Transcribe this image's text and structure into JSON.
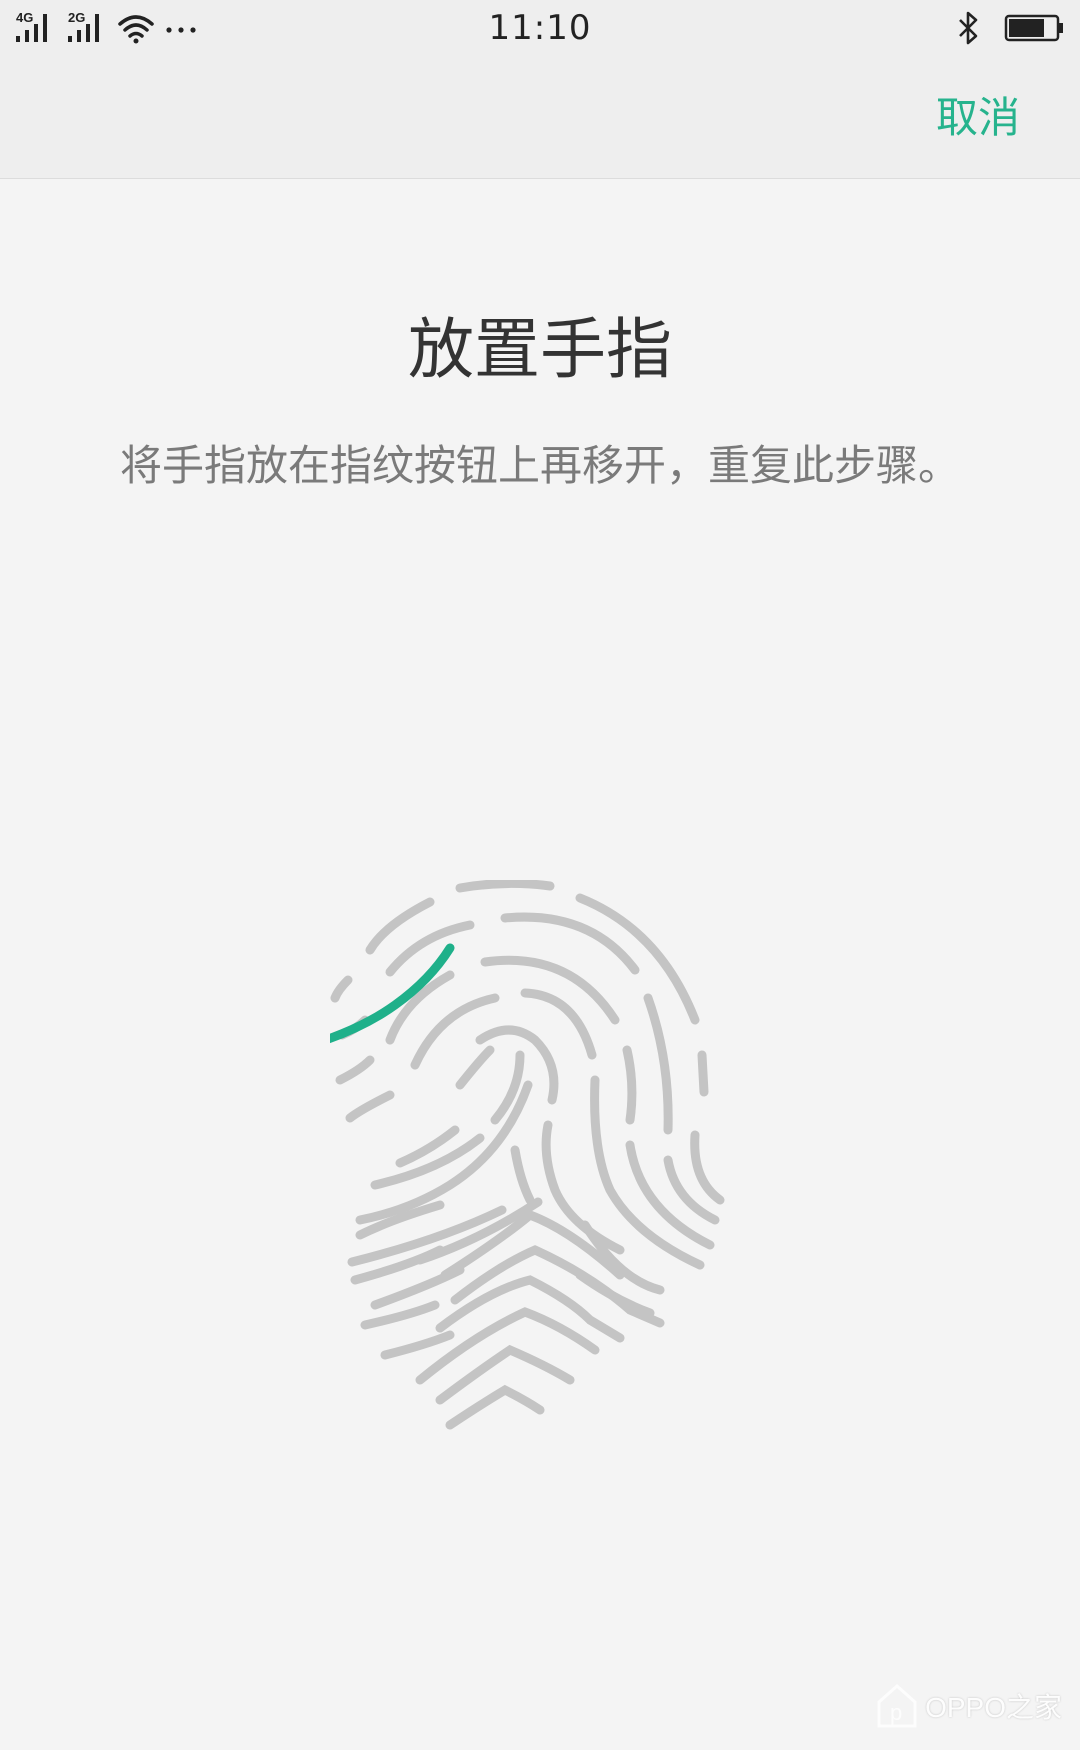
{
  "status_bar": {
    "network_1": "4G",
    "network_2": "2G",
    "more_indicator": "···",
    "time": "11:10",
    "icons": [
      "signal-icon",
      "signal-icon",
      "wifi-icon",
      "bluetooth-icon",
      "battery-icon"
    ],
    "battery_level": 0.75
  },
  "top_bar": {
    "cancel_label": "取消"
  },
  "main": {
    "title": "放置手指",
    "instruction": "将手指放在指纹按钮上再移开，重复此步骤。"
  },
  "fingerprint": {
    "icon": "fingerprint-icon",
    "ridge_color": "#c4c4c4",
    "progress_color": "#1fb08a"
  },
  "watermark": {
    "text": "OPPO之家"
  },
  "colors": {
    "accent": "#26b38d",
    "background": "#f4f4f4",
    "bar_background": "#eeeeee"
  }
}
